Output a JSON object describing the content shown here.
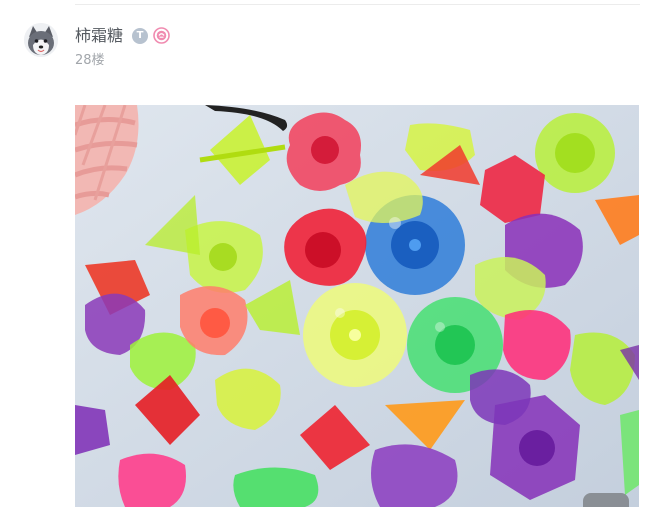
{
  "post": {
    "author_name": "柿霜糖",
    "level_badge_letter": "T",
    "level_badge_color": "#b7c2cf",
    "flower_badge_color": "#f08bb0",
    "floor": "28楼"
  },
  "icons": {
    "avatar": "husky-avatar",
    "level_badge": "level-badge-icon",
    "flower_badge": "flower-badge-icon"
  }
}
